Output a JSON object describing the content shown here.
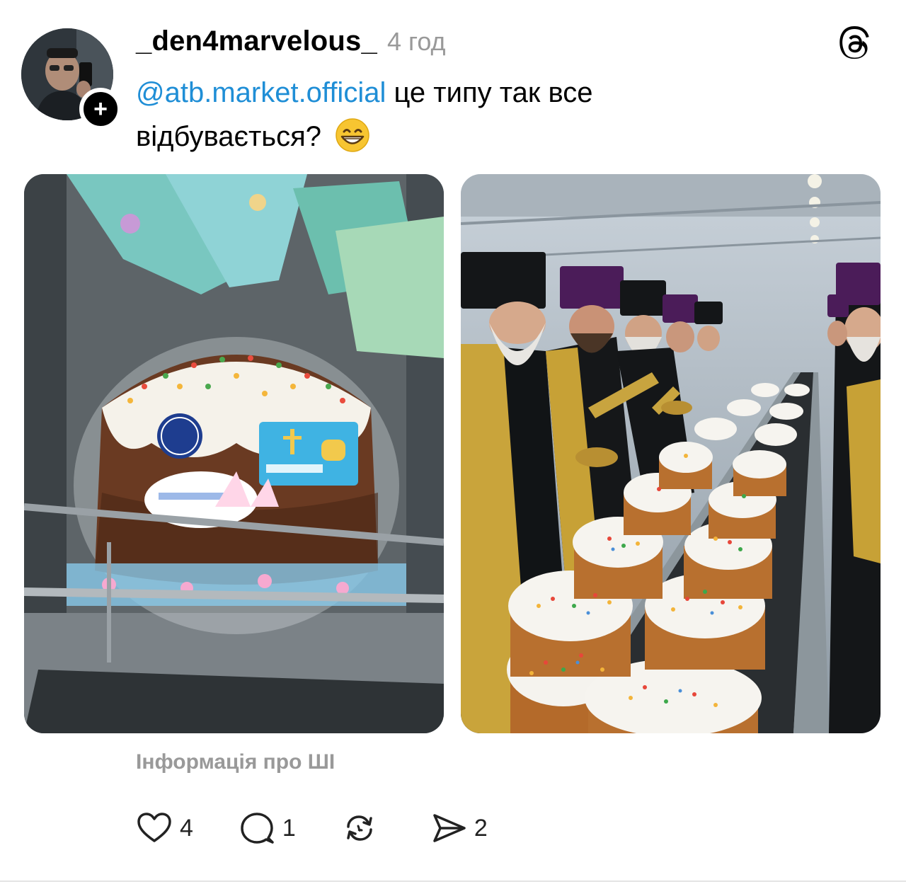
{
  "post": {
    "username": "_den4marvelous_",
    "timestamp": "4 год",
    "follow_label": "+",
    "caption": {
      "mention": "@atb.market.official",
      "text": " це типу так все відбувається?"
    },
    "ai_info": "Інформація про ШІ",
    "images": [
      {
        "icon": "photo-icon",
        "description_name": "easter-cake-in-store"
      },
      {
        "icon": "photo-icon",
        "description_name": "priests-blessing-conveyor"
      }
    ]
  },
  "actions": {
    "like_count": "4",
    "reply_count": "1",
    "repost_count": "",
    "share_count": "2"
  },
  "colors": {
    "mention": "#1f8ed6",
    "muted": "#999999",
    "text": "#000000"
  },
  "icons": [
    "threads-logo-icon",
    "heart-icon",
    "comment-icon",
    "repost-icon",
    "share-icon",
    "grin-emoji-icon"
  ]
}
